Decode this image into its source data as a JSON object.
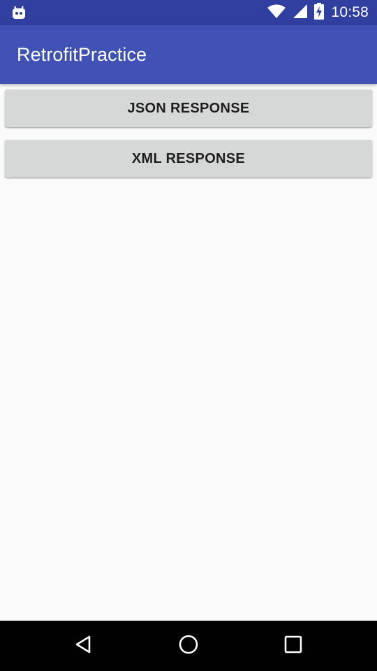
{
  "status_bar": {
    "time": "10:58",
    "notification_icon": "android-debug-icon",
    "icons": [
      "wifi-icon",
      "signal-icon",
      "battery-charging-icon"
    ]
  },
  "app_bar": {
    "title": "RetrofitPractice",
    "color": "#3f51b5",
    "status_color": "#303f9f"
  },
  "main": {
    "buttons": [
      {
        "label": "JSON RESPONSE"
      },
      {
        "label": "XML RESPONSE"
      }
    ]
  },
  "nav_bar": {
    "buttons": [
      "back-icon",
      "home-icon",
      "recents-icon"
    ]
  }
}
